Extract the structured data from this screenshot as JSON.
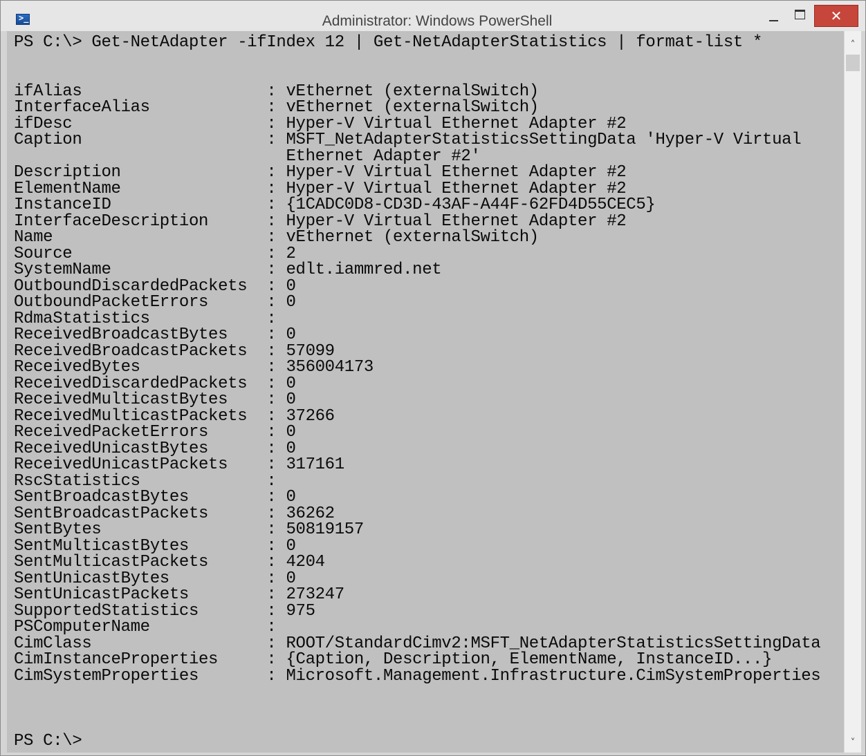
{
  "window": {
    "title": "Administrator: Windows PowerShell",
    "icon": "powershell-icon",
    "controls": {
      "minimize_icon": "minimize-icon",
      "maximize_icon": "maximize-icon",
      "close_glyph": "✕"
    },
    "accent_close": "#c6463c",
    "console_background": "#c0c0c0"
  },
  "console": {
    "text": "PS C:\\> Get-NetAdapter -ifIndex 12 | Get-NetAdapterStatistics | format-list *\n\n\nifAlias                   : vEthernet (externalSwitch)\nInterfaceAlias            : vEthernet (externalSwitch)\nifDesc                    : Hyper-V Virtual Ethernet Adapter #2\nCaption                   : MSFT_NetAdapterStatisticsSettingData 'Hyper-V Virtual\n                            Ethernet Adapter #2'\nDescription               : Hyper-V Virtual Ethernet Adapter #2\nElementName               : Hyper-V Virtual Ethernet Adapter #2\nInstanceID                : {1CADC0D8-CD3D-43AF-A44F-62FD4D55CEC5}\nInterfaceDescription      : Hyper-V Virtual Ethernet Adapter #2\nName                      : vEthernet (externalSwitch)\nSource                    : 2\nSystemName                : edlt.iammred.net\nOutboundDiscardedPackets  : 0\nOutboundPacketErrors      : 0\nRdmaStatistics            :\nReceivedBroadcastBytes    : 0\nReceivedBroadcastPackets  : 57099\nReceivedBytes             : 356004173\nReceivedDiscardedPackets  : 0\nReceivedMulticastBytes    : 0\nReceivedMulticastPackets  : 37266\nReceivedPacketErrors      : 0\nReceivedUnicastBytes      : 0\nReceivedUnicastPackets    : 317161\nRscStatistics             :\nSentBroadcastBytes        : 0\nSentBroadcastPackets      : 36262\nSentBytes                 : 50819157\nSentMulticastBytes        : 0\nSentMulticastPackets      : 4204\nSentUnicastBytes          : 0\nSentUnicastPackets        : 273247\nSupportedStatistics       : 975\nPSComputerName            :\nCimClass                  : ROOT/StandardCimv2:MSFT_NetAdapterStatisticsSettingData\nCimInstanceProperties     : {Caption, Description, ElementName, InstanceID...}\nCimSystemProperties       : Microsoft.Management.Infrastructure.CimSystemProperties\n\n\n\nPS C:\\>"
  },
  "scrollbar": {
    "up_glyph": "˄",
    "down_glyph": "˅"
  }
}
